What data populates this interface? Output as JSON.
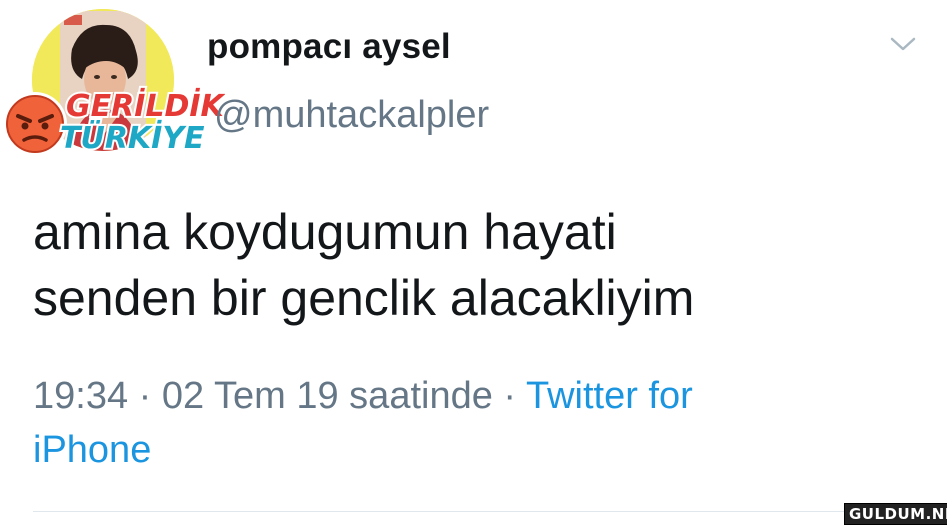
{
  "tweet": {
    "display_name": "pompacı aysel",
    "username": "@muhtackalpler",
    "text_lines": [
      "amina koydugumun hayati",
      "senden bir genclik alacakliyim"
    ],
    "time": "19:34",
    "separator": "·",
    "date": "02 Tem 19 saatinde",
    "source_line1": "Twitter for",
    "source_line2": "iPhone"
  },
  "overlay": {
    "logo_line1": "GERİLDİK",
    "logo_line2": "TÜRKİYE",
    "site_watermark": "GULDUM.NET"
  },
  "icons": {
    "menu": "chevron-down-icon",
    "logo_face": "angry-face-icon"
  },
  "colors": {
    "text": "#14171a",
    "secondary": "#657786",
    "link": "#1b95e0",
    "logo_red": "#e53935",
    "logo_teal": "#1fa7c6"
  }
}
